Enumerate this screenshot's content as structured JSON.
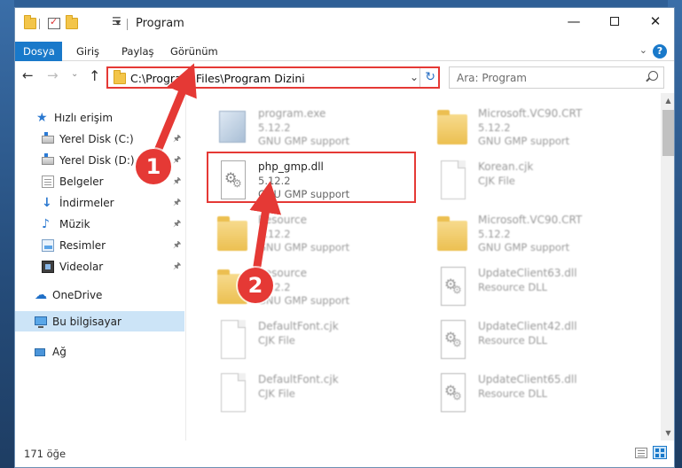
{
  "window": {
    "title": "Program",
    "minimize": "—",
    "close": "✕"
  },
  "quick_access": {
    "dropdown": "▾",
    "customize": "☰"
  },
  "ribbon": {
    "tabs": [
      {
        "label": "Dosya",
        "active": true
      },
      {
        "label": "Giriş"
      },
      {
        "label": "Paylaş"
      },
      {
        "label": "Görünüm"
      }
    ],
    "help": "?",
    "expand": "⌄"
  },
  "nav": {
    "back": "←",
    "forward": "→",
    "recent": "⌄",
    "up": "↑",
    "refresh": "↻",
    "address_dropdown": "⌄"
  },
  "address": {
    "path": "C:\\Program Files\\Program Dizini"
  },
  "search": {
    "placeholder": "Ara: Program"
  },
  "sidebar": {
    "items": [
      {
        "label": "Hızlı erişim",
        "icon": "star-icon"
      },
      {
        "label": "Yerel Disk (C:)",
        "icon": "disk-icon",
        "pinned": true
      },
      {
        "label": "Yerel Disk (D:)",
        "icon": "disk-icon",
        "pinned": true
      },
      {
        "label": "Belgeler",
        "icon": "documents-icon",
        "pinned": true
      },
      {
        "label": "İndirmeler",
        "icon": "download-icon",
        "pinned": true
      },
      {
        "label": "Müzik",
        "icon": "music-icon",
        "pinned": true
      },
      {
        "label": "Resimler",
        "icon": "pictures-icon",
        "pinned": true
      },
      {
        "label": "Videolar",
        "icon": "video-icon",
        "pinned": true
      },
      {
        "label": "OneDrive",
        "icon": "cloud-icon"
      },
      {
        "label": "Bu bilgisayar",
        "icon": "computer-icon",
        "selected": true
      },
      {
        "label": "Ağ",
        "icon": "network-icon"
      }
    ],
    "pin_glyph": "📌"
  },
  "files": {
    "left": [
      {
        "name": "program.exe",
        "version": "5.12.2",
        "desc": "GNU GMP support",
        "icon": "exe-icon",
        "blurred": true
      },
      {
        "name": "php_gmp.dll",
        "version": "5.12.2",
        "desc": "GNU GMP support",
        "icon": "dll-icon",
        "highlighted": true
      },
      {
        "name": "Resource",
        "version": "5.12.2",
        "desc": "GNU GMP support",
        "icon": "folder-icon",
        "blurred": true
      },
      {
        "name": "Resource",
        "version": "5.12.2",
        "desc": "GNU GMP support",
        "icon": "folder-icon",
        "blurred": true
      },
      {
        "name": "DefaultFont.cjk",
        "version": "CJK File",
        "desc": "",
        "icon": "document-icon",
        "blurred": true
      },
      {
        "name": "DefaultFont.cjk",
        "version": "CJK File",
        "desc": "",
        "icon": "document-icon",
        "blurred": true
      }
    ],
    "right": [
      {
        "name": "Microsoft.VC90.CRT",
        "version": "5.12.2",
        "desc": "GNU GMP support",
        "icon": "folder-icon",
        "blurred": true
      },
      {
        "name": "Korean.cjk",
        "version": "CJK File",
        "desc": "",
        "icon": "document-icon",
        "blurred": true
      },
      {
        "name": "Microsoft.VC90.CRT",
        "version": "5.12.2",
        "desc": "GNU GMP support",
        "icon": "folder-icon",
        "blurred": true
      },
      {
        "name": "UpdateClient63.dll",
        "version": "Resource DLL",
        "desc": "",
        "icon": "dll-icon",
        "blurred": true
      },
      {
        "name": "UpdateClient42.dll",
        "version": "Resource DLL",
        "desc": "",
        "icon": "dll-icon",
        "blurred": true
      },
      {
        "name": "UpdateClient65.dll",
        "version": "Resource DLL",
        "desc": "",
        "icon": "dll-icon",
        "blurred": true
      }
    ]
  },
  "status": {
    "count": "171 öğe"
  },
  "annotations": {
    "step1": "1",
    "step2": "2",
    "color": "#e53935"
  },
  "colors": {
    "accent": "#1979ca",
    "selected": "#cce4f7"
  }
}
